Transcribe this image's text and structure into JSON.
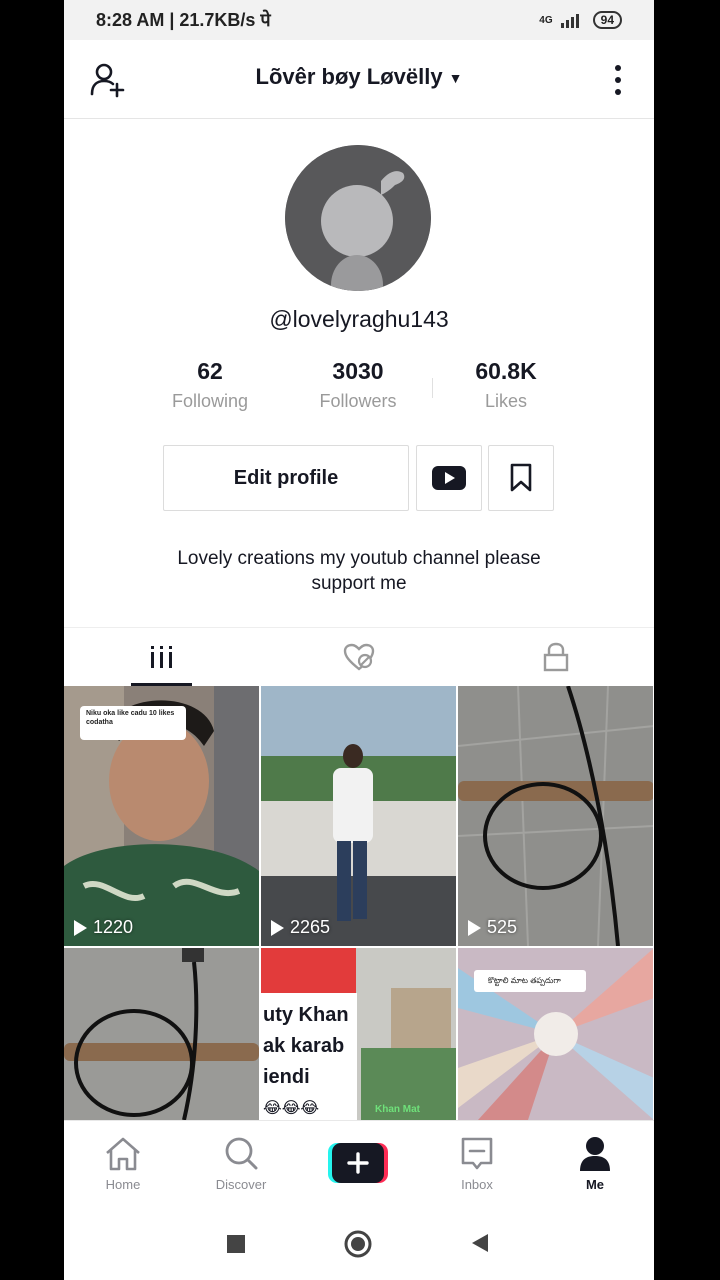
{
  "status_bar": {
    "time_speed": "8:28 AM | 21.7KB/s पे",
    "battery": "94",
    "network": "4G"
  },
  "header": {
    "title": "Lõvêr bøy Løvëlly",
    "add_user_icon": "add-user-icon",
    "more_icon": "more-vertical-icon"
  },
  "profile": {
    "username": "@lovelyraghu143",
    "stats": [
      {
        "value": "62",
        "label": "Following"
      },
      {
        "value": "3030",
        "label": "Followers"
      },
      {
        "value": "60.8K",
        "label": "Likes"
      }
    ],
    "edit_label": "Edit profile",
    "bio": "Lovely creations my youtub channel please support me"
  },
  "tabs": [
    {
      "icon": "grid-icon",
      "active": true
    },
    {
      "icon": "liked-heart-icon",
      "active": false
    },
    {
      "icon": "lock-icon",
      "active": false
    }
  ],
  "videos": [
    {
      "plays": "1220",
      "caption": "Niku oka like cadu 10 likes codatha"
    },
    {
      "plays": "2265"
    },
    {
      "plays": "525"
    },
    {
      "plays": ""
    },
    {
      "plays": "",
      "overlay_lines": [
        "uty Khan",
        "ak karab",
        "iendi",
        "😂😂😂"
      ],
      "corner_text": "Khan Mat"
    },
    {
      "plays": "",
      "caption": "కొట్టాలి మాట తప్పదుగా"
    }
  ],
  "bottom_nav": [
    {
      "label": "Home",
      "icon": "home-icon"
    },
    {
      "label": "Discover",
      "icon": "search-icon"
    },
    {
      "label": "",
      "icon": "plus-icon"
    },
    {
      "label": "Inbox",
      "icon": "inbox-icon"
    },
    {
      "label": "Me",
      "icon": "person-icon"
    }
  ],
  "colors": {
    "text_primary": "#161823",
    "text_secondary": "#9a9a9a",
    "plus_cyan": "#25f4ee",
    "plus_red": "#fe2c55"
  }
}
